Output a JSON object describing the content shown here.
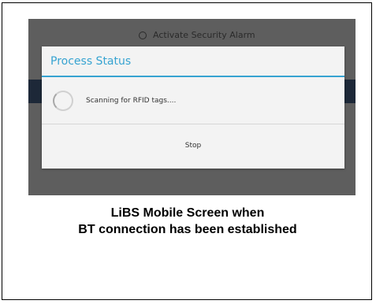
{
  "background": {
    "radio_label": "Activate Security Alarm"
  },
  "dialog": {
    "title": "Process Status",
    "message": "Scanning for RFID tags....",
    "stop_label": "Stop"
  },
  "caption": {
    "line1": "LiBS Mobile Screen when",
    "line2": "BT connection has been established"
  },
  "colors": {
    "accent": "#36a3d1",
    "overlay": "#5e5e5e",
    "band": "#1d2838"
  },
  "icons": {
    "spinner": "loading-spinner-icon",
    "radio": "radio-button-icon"
  }
}
